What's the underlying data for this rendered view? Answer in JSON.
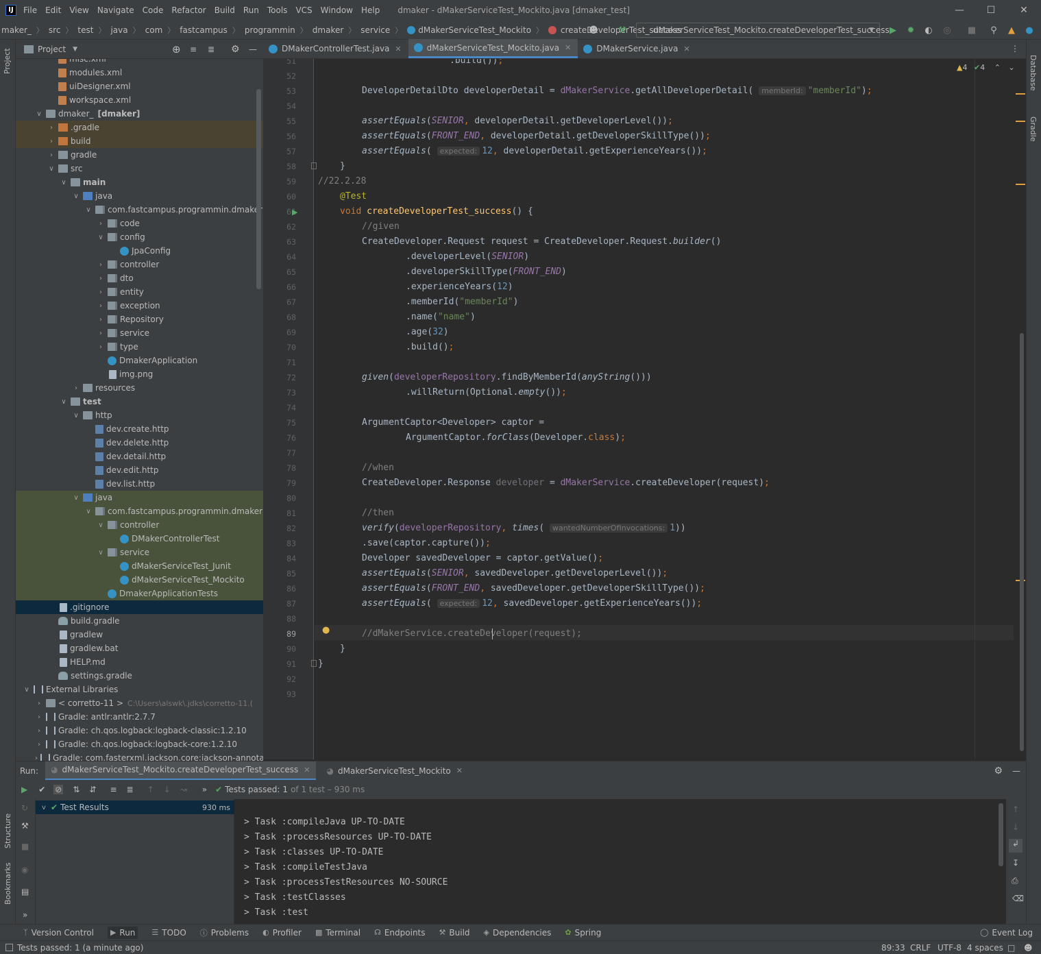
{
  "window": {
    "title": "dmaker - dMakerServiceTest_Mockito.java [dmaker_test]",
    "logo": "IJ",
    "menus": [
      "File",
      "Edit",
      "View",
      "Navigate",
      "Code",
      "Refactor",
      "Build",
      "Run",
      "Tools",
      "VCS",
      "Window",
      "Help"
    ],
    "controls": {
      "minimize": "—",
      "maximize": "☐",
      "close": "✕"
    }
  },
  "breadcrumbs": [
    "maker_",
    "src",
    "test",
    "java",
    "com",
    "fastcampus",
    "programmin",
    "dmaker",
    "service",
    "dMakerServiceTest_Mockito",
    "createDeveloperTest_success"
  ],
  "run_config": "dMakerServiceTest_Mockito.createDeveloperTest_success",
  "left_stripe": {
    "project": "Project",
    "structure": "Structure",
    "bookmarks": "Bookmarks"
  },
  "right_stripe": {
    "database": "Database",
    "gradle": "Gradle"
  },
  "project_panel": {
    "title": "Project",
    "tree": [
      {
        "label": "misc.xml",
        "depth": 2,
        "icon": "xml",
        "arrow": ""
      },
      {
        "label": "modules.xml",
        "depth": 2,
        "icon": "xml",
        "arrow": ""
      },
      {
        "label": "uiDesigner.xml",
        "depth": 2,
        "icon": "xml",
        "arrow": ""
      },
      {
        "label": "workspace.xml",
        "depth": 2,
        "icon": "xml",
        "arrow": ""
      },
      {
        "label": "dmaker_",
        "suffix": "[dmaker]",
        "depth": 1,
        "icon": "folder",
        "arrow": "v"
      },
      {
        "label": ".gradle",
        "depth": 2,
        "icon": "folder orange",
        "arrow": ">",
        "hl": "orange"
      },
      {
        "label": "build",
        "depth": 2,
        "icon": "folder orange",
        "arrow": ">",
        "hl": "orange"
      },
      {
        "label": "gradle",
        "depth": 2,
        "icon": "folder",
        "arrow": ">"
      },
      {
        "label": "src",
        "depth": 2,
        "icon": "folder",
        "arrow": "v"
      },
      {
        "label": "main",
        "depth": 3,
        "icon": "folder",
        "arrow": "v",
        "bold": true
      },
      {
        "label": "java",
        "depth": 4,
        "icon": "folder blue",
        "arrow": "v"
      },
      {
        "label": "com.fastcampus.programmin.dmaker",
        "depth": 5,
        "icon": "pkg",
        "arrow": "v"
      },
      {
        "label": "code",
        "depth": 6,
        "icon": "pkg",
        "arrow": ">"
      },
      {
        "label": "config",
        "depth": 6,
        "icon": "pkg",
        "arrow": "v"
      },
      {
        "label": "JpaConfig",
        "depth": 7,
        "icon": "cls",
        "arrow": ""
      },
      {
        "label": "controller",
        "depth": 6,
        "icon": "pkg",
        "arrow": ">"
      },
      {
        "label": "dto",
        "depth": 6,
        "icon": "pkg",
        "arrow": ">"
      },
      {
        "label": "entity",
        "depth": 6,
        "icon": "pkg",
        "arrow": ">"
      },
      {
        "label": "exception",
        "depth": 6,
        "icon": "pkg",
        "arrow": ">"
      },
      {
        "label": "Repository",
        "depth": 6,
        "icon": "pkg",
        "arrow": ">"
      },
      {
        "label": "service",
        "depth": 6,
        "icon": "pkg",
        "arrow": ">"
      },
      {
        "label": "type",
        "depth": 6,
        "icon": "pkg",
        "arrow": ">"
      },
      {
        "label": "DmakerApplication",
        "depth": 6,
        "icon": "cls",
        "arrow": ""
      },
      {
        "label": "img.png",
        "depth": 6,
        "icon": "file",
        "arrow": ""
      },
      {
        "label": "resources",
        "depth": 4,
        "icon": "folder",
        "arrow": ">"
      },
      {
        "label": "test",
        "depth": 3,
        "icon": "folder",
        "arrow": "v",
        "bold": true
      },
      {
        "label": "http",
        "depth": 4,
        "icon": "folder",
        "arrow": "v"
      },
      {
        "label": "dev.create.http",
        "depth": 5,
        "icon": "api",
        "arrow": ""
      },
      {
        "label": "dev.delete.http",
        "depth": 5,
        "icon": "api",
        "arrow": ""
      },
      {
        "label": "dev.detail.http",
        "depth": 5,
        "icon": "api",
        "arrow": ""
      },
      {
        "label": "dev.edit.http",
        "depth": 5,
        "icon": "api",
        "arrow": ""
      },
      {
        "label": "dev.list.http",
        "depth": 5,
        "icon": "api",
        "arrow": ""
      },
      {
        "label": "java",
        "depth": 4,
        "icon": "folder blue",
        "arrow": "v",
        "hl": "green"
      },
      {
        "label": "com.fastcampus.programmin.dmaker",
        "depth": 5,
        "icon": "pkg",
        "arrow": "v",
        "hl": "green"
      },
      {
        "label": "controller",
        "depth": 6,
        "icon": "pkg",
        "arrow": "v",
        "hl": "green"
      },
      {
        "label": "DMakerControllerTest",
        "depth": 7,
        "icon": "cls",
        "arrow": "",
        "hl": "green"
      },
      {
        "label": "service",
        "depth": 6,
        "icon": "pkg",
        "arrow": "v",
        "hl": "green"
      },
      {
        "label": "dMakerServiceTest_Junit",
        "depth": 7,
        "icon": "cls",
        "arrow": "",
        "hl": "green"
      },
      {
        "label": "dMakerServiceTest_Mockito",
        "depth": 7,
        "icon": "cls",
        "arrow": "",
        "hl": "green"
      },
      {
        "label": "DmakerApplicationTests",
        "depth": 6,
        "icon": "cls",
        "arrow": "",
        "hl": "green"
      },
      {
        "label": ".gitignore",
        "depth": 2,
        "icon": "file",
        "arrow": "",
        "hl": "sel"
      },
      {
        "label": "build.gradle",
        "depth": 2,
        "icon": "gradle",
        "arrow": ""
      },
      {
        "label": "gradlew",
        "depth": 2,
        "icon": "file",
        "arrow": ""
      },
      {
        "label": "gradlew.bat",
        "depth": 2,
        "icon": "file",
        "arrow": ""
      },
      {
        "label": "HELP.md",
        "depth": 2,
        "icon": "file",
        "arrow": ""
      },
      {
        "label": "settings.gradle",
        "depth": 2,
        "icon": "gradle",
        "arrow": ""
      },
      {
        "label": "External Libraries",
        "depth": 0,
        "icon": "lib",
        "arrow": "v"
      },
      {
        "label": "< corretto-11 >",
        "suffix": "C:\\Users\\alswk\\.jdks\\corretto-11.(",
        "depth": 1,
        "icon": "folder",
        "arrow": ">"
      },
      {
        "label": "Gradle: antlr:antlr:2.7.7",
        "depth": 1,
        "icon": "lib",
        "arrow": ">"
      },
      {
        "label": "Gradle: ch.qos.logback:logback-classic:1.2.10",
        "depth": 1,
        "icon": "lib",
        "arrow": ">"
      },
      {
        "label": "Gradle: ch.qos.logback:logback-core:1.2.10",
        "depth": 1,
        "icon": "lib",
        "arrow": ">"
      },
      {
        "label": "Gradle: com.fasterxml.jackson.core:jackson-annotatio",
        "depth": 1,
        "icon": "lib",
        "arrow": ">"
      }
    ]
  },
  "editor_tabs": [
    {
      "label": "DMakerControllerTest.java",
      "active": false
    },
    {
      "label": "dMakerServiceTest_Mockito.java",
      "active": true
    },
    {
      "label": "DMakerService.java",
      "active": false
    }
  ],
  "inspection": {
    "warnings": "4",
    "ok": "4"
  },
  "line_numbers": [
    "51",
    "52",
    "53",
    "54",
    "55",
    "56",
    "57",
    "58",
    "59",
    "60",
    "61",
    "62",
    "63",
    "64",
    "65",
    "66",
    "67",
    "68",
    "69",
    "70",
    "71",
    "72",
    "73",
    "74",
    "75",
    "76",
    "77",
    "78",
    "79",
    "80",
    "81",
    "82",
    "83",
    "84",
    "85",
    "86",
    "87",
    "88",
    "89",
    "90",
    "91",
    "92",
    "93"
  ],
  "current_line": "89",
  "code_lines": [
    ".build());",
    "",
    "DeveloperDetailDto developerDetail = dMakerService.getAllDeveloperDetail( memberId: \"memberId\");",
    "",
    "assertEquals(SENIOR, developerDetail.getDeveloperLevel());",
    "assertEquals(FRONT_END, developerDetail.getDeveloperSkillType());",
    "assertEquals( expected: 12, developerDetail.getExperienceYears());",
    "}",
    "//22.2.28",
    "@Test",
    "void createDeveloperTest_success() {",
    "//given",
    "CreateDeveloper.Request request = CreateDeveloper.Request.builder()",
    ".developerLevel(SENIOR)",
    ".developerSkillType(FRONT_END)",
    ".experienceYears(12)",
    ".memberId(\"memberId\")",
    ".name(\"name\")",
    ".age(32)",
    ".build();",
    "",
    "given(developerRepository.findByMemberId(anyString()))",
    ".willReturn(Optional.empty());",
    "",
    "ArgumentCaptor<Developer> captor =",
    "ArgumentCaptor.forClass(Developer.class);",
    "",
    "//when",
    "CreateDeveloper.Response developer = dMakerService.createDeveloper(request);",
    "",
    "//then",
    "verify(developerRepository, times( wantedNumberOfInvocations: 1))",
    ".save(captor.capture());",
    "Developer savedDeveloper = captor.getValue();",
    "assertEquals(SENIOR, savedDeveloper.getDeveloperLevel());",
    "assertEquals(FRONT_END, savedDeveloper.getDeveloperSkillType());",
    "assertEquals( expected: 12, savedDeveloper.getExperienceYears());",
    "",
    "//dMakerService.createDeveloper(request);",
    "}",
    "}",
    "",
    ""
  ],
  "run_panel": {
    "label": "Run:",
    "tabs": [
      "dMakerServiceTest_Mockito.createDeveloperTest_success",
      "dMakerServiceTest_Mockito"
    ],
    "status_prefix": "Tests passed:",
    "status_count": "1",
    "status_suffix": "of 1 test – 930 ms",
    "tree_root": "Test Results",
    "tree_time": "930 ms",
    "console": [
      "> Task :compileJava UP-TO-DATE",
      "> Task :processResources UP-TO-DATE",
      "> Task :classes UP-TO-DATE",
      "> Task :compileTestJava",
      "> Task :processTestResources NO-SOURCE",
      "> Task :testClasses",
      "> Task :test"
    ]
  },
  "tool_windows": [
    "Version Control",
    "Run",
    "TODO",
    "Problems",
    "Profiler",
    "Terminal",
    "Endpoints",
    "Build",
    "Dependencies",
    "Spring"
  ],
  "event_log": "Event Log",
  "status_bar": {
    "message": "Tests passed: 1 (a minute ago)",
    "position": "89:33",
    "line_sep": "CRLF",
    "encoding": "UTF-8",
    "indent": "4 spaces"
  },
  "colors": {
    "accent": "#4a88c7",
    "run_green": "#59a869",
    "warning": "#e0b64d",
    "bg_editor": "#2b2b2b",
    "bg_panel": "#3c3f41"
  }
}
